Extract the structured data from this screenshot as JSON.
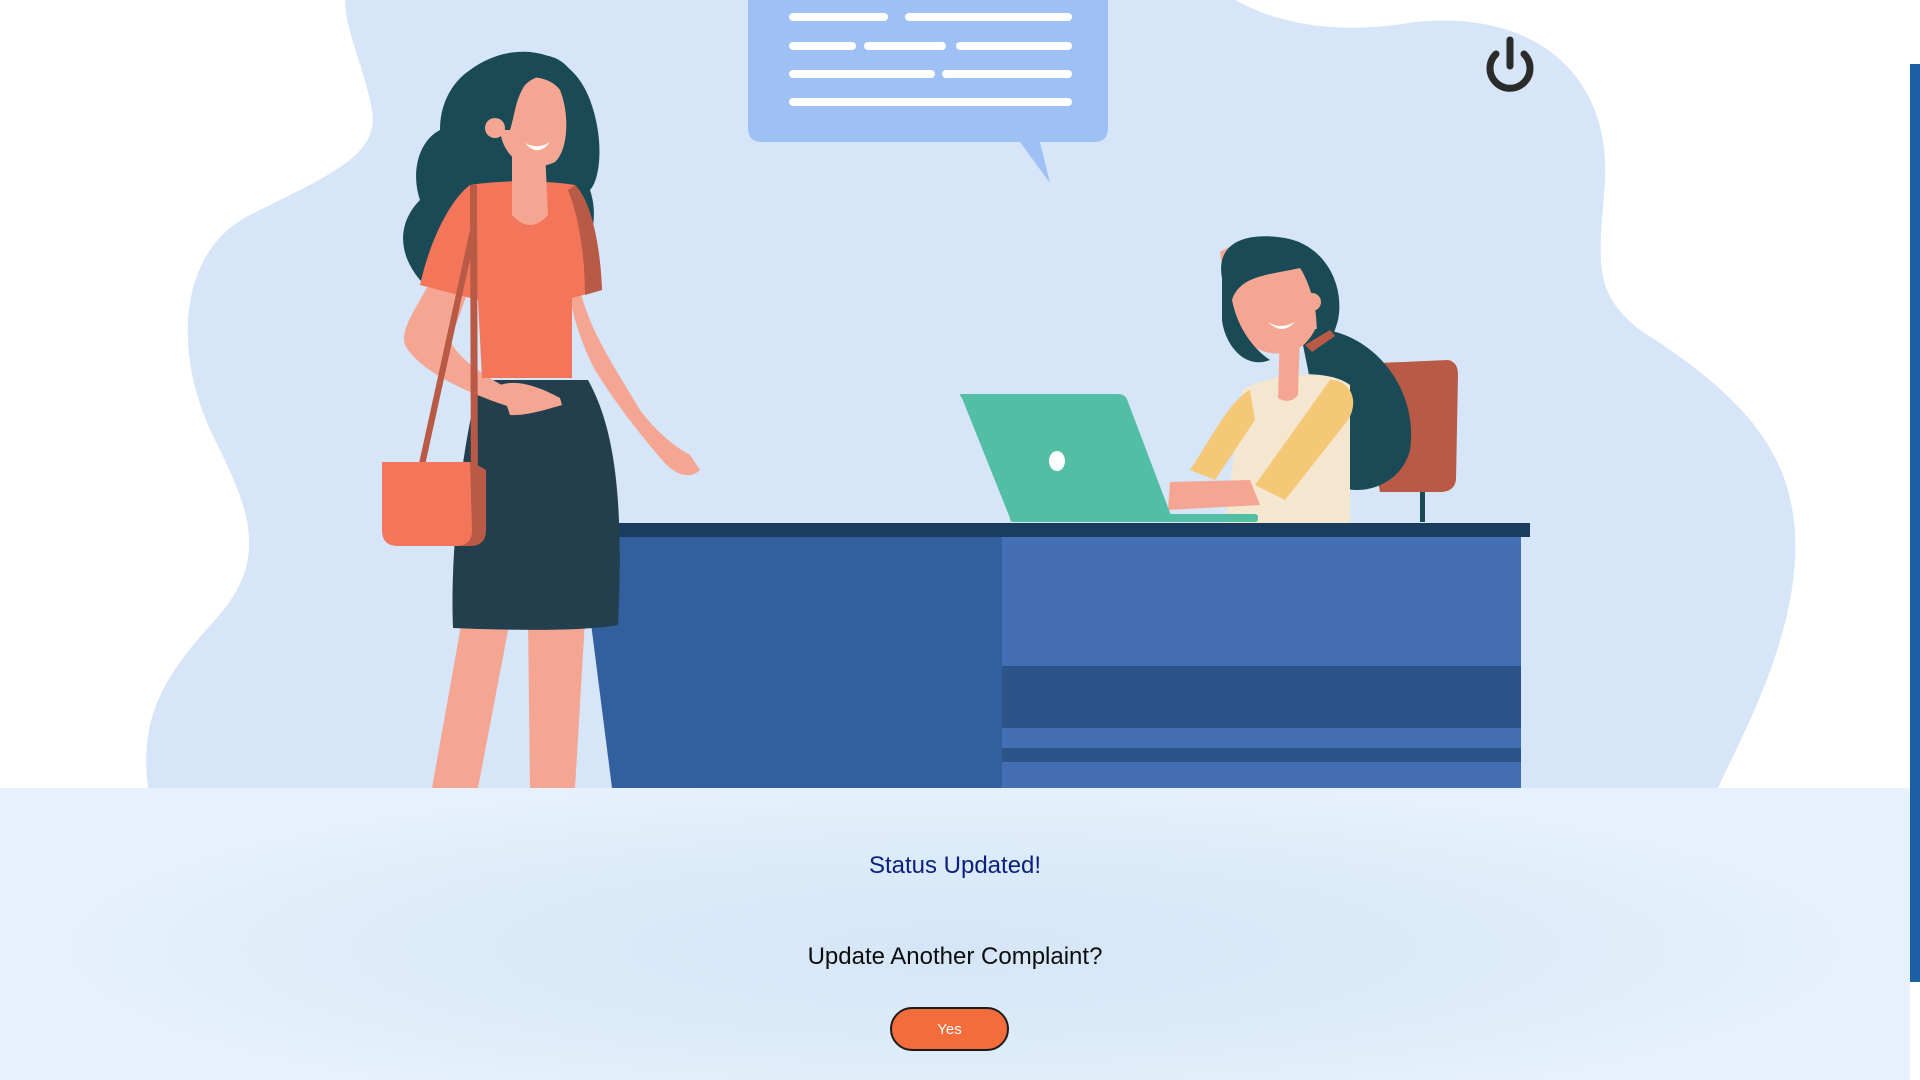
{
  "header": {
    "power_button_icon": "power-icon"
  },
  "illustration": {
    "description_icons": [
      "speech-bubble",
      "standing-woman",
      "seated-woman",
      "laptop",
      "desk",
      "chair",
      "handbag"
    ]
  },
  "result": {
    "status_message": "Status Updated!",
    "question": "Update Another Complaint?",
    "yes_label": "Yes"
  },
  "colors": {
    "accent": "#f36c3c",
    "status_text": "#0c1f7a",
    "panel_bg": "#dcebf9",
    "scrollbar_thumb": "#1b5fa4"
  }
}
